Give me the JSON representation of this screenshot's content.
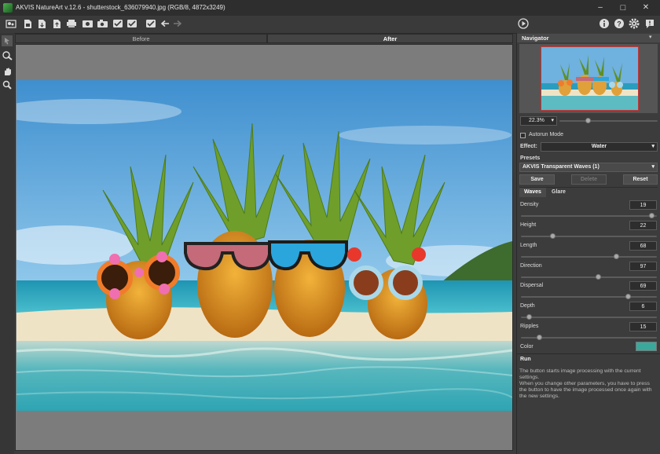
{
  "window": {
    "title": "AKVIS NatureArt v.12.6 - shutterstock_636079940.jpg (RGB/8, 4872x3249)",
    "minimize": "–",
    "maximize": "□",
    "close": "✕"
  },
  "toolbar": {
    "icons": [
      "home-icon",
      "open-file-icon",
      "save-file-icon",
      "export-icon",
      "print-icon",
      "batch-icon",
      "camera-icon",
      "brush-check-icon",
      "check-icon",
      "check-mark-icon",
      "undo-icon",
      "redo-icon"
    ],
    "right_icons": [
      "run-icon",
      "info-icon",
      "help-icon",
      "settings-icon",
      "notification-icon"
    ]
  },
  "left_tools": [
    "arrow-tool-icon",
    "brush-tool-icon",
    "hand-tool-icon",
    "zoom-tool-icon"
  ],
  "view_tabs": {
    "before": "Before",
    "after": "After",
    "active": "After"
  },
  "navigator": {
    "title": "Navigator",
    "zoom": "22.3%",
    "zoom_level_fraction": 0.28
  },
  "settings": {
    "autorun_label": "Autorun Mode",
    "autorun_checked": false,
    "effect_label": "Effect:",
    "effect_value": "Water",
    "presets_label": "Presets",
    "preset_value": "AKVIS Transparent Waves (1)",
    "save": "Save",
    "delete": "Delete",
    "reset": "Reset",
    "tabs": [
      "Waves",
      "Glare"
    ],
    "active_tab": "Waves",
    "params": [
      {
        "name": "Density",
        "value": 19
      },
      {
        "name": "Height",
        "value": 22
      },
      {
        "name": "Length",
        "value": 68
      },
      {
        "name": "Direction",
        "value": 97
      },
      {
        "name": "Dispersal",
        "value": 69
      },
      {
        "name": "Depth",
        "value": 6
      },
      {
        "name": "Ripples",
        "value": 15
      }
    ],
    "slider_fractions": [
      0.98,
      0.22,
      0.71,
      0.57,
      0.8,
      0.04,
      0.12
    ],
    "color_label": "Color",
    "color_value": "#3aa89c"
  },
  "help": {
    "title": "Run",
    "line1": "The button starts image processing with the current settings.",
    "line2": "When you change other parameters, you have to press the button to have the image processed once again with the new settings."
  }
}
